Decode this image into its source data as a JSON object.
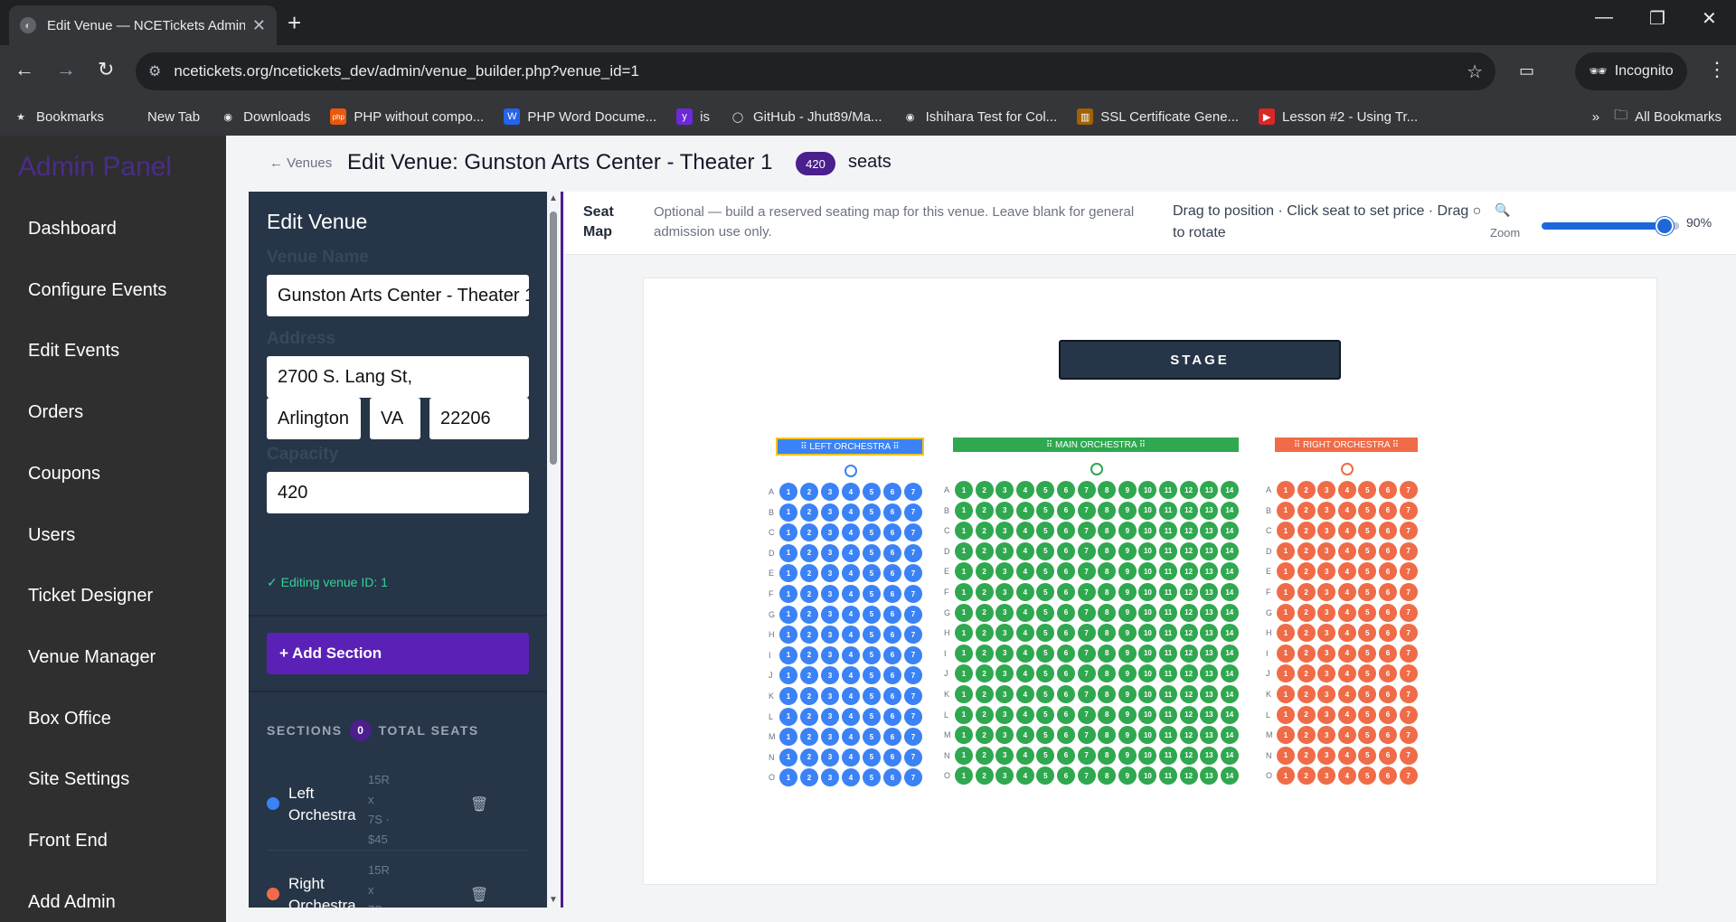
{
  "browser": {
    "tab_title": "Edit Venue — NCETickets Admin",
    "url": "ncetickets.org/ncetickets_dev/admin/venue_builder.php?venue_id=1",
    "profile": "Incognito",
    "bookmarks": [
      {
        "label": "Bookmarks",
        "icon": "star-icon"
      },
      {
        "label": "New Tab",
        "icon": "page-icon"
      },
      {
        "label": "Downloads",
        "icon": "globe-icon"
      },
      {
        "label": "PHP without compo...",
        "icon": "php-icon"
      },
      {
        "label": "PHP Word Docume...",
        "icon": "php-doc-icon"
      },
      {
        "label": "is",
        "icon": "yahoo-icon"
      },
      {
        "label": "GitHub - Jhut89/Ma...",
        "icon": "github-icon"
      },
      {
        "label": "Ishihara Test for Col...",
        "icon": "globe-icon"
      },
      {
        "label": "SSL Certificate Gene...",
        "icon": "ssl-icon"
      },
      {
        "label": "Lesson #2 - Using Tr...",
        "icon": "youtube-icon"
      }
    ],
    "all_bookmarks": "All Bookmarks"
  },
  "sidebar": {
    "title": "Admin Panel",
    "items": [
      "Dashboard",
      "Configure Events",
      "Edit Events",
      "Orders",
      "Coupons",
      "Users",
      "Ticket Designer",
      "Venue Manager",
      "Box Office",
      "Site Settings",
      "Front End",
      "Add Admin"
    ]
  },
  "header": {
    "back": "← Venues",
    "title": "Edit Venue: Gunston Arts Center - Theater 1",
    "seat_count": "420",
    "seat_word": "seats"
  },
  "editor": {
    "heading": "Edit Venue",
    "venue_name_label": "Venue Name",
    "venue_name": "Gunston Arts Center - Theater 1",
    "address_label": "Address",
    "address": "2700 S. Lang St,",
    "city": "Arlington",
    "state": "VA",
    "zip": "22206",
    "capacity_label": "Capacity",
    "capacity": "420",
    "note": "✓ Editing venue ID: 1",
    "add_section": "+ Add Section",
    "sections_label": "SECTIONS",
    "sections_count": "0",
    "total_seats_label": "TOTAL SEATS",
    "sections": [
      {
        "name": "Left Orchestra",
        "meta": [
          "15R",
          "x",
          "7S ·",
          "$45"
        ],
        "color": "#3b82f6"
      },
      {
        "name": "Right Orchestra",
        "meta": [
          "15R",
          "x",
          "7S ·",
          "$45"
        ],
        "color": "#f06b47"
      }
    ]
  },
  "map": {
    "title": "Seat Map",
    "hint": "Optional — build a reserved seating map for this venue. Leave blank for general admission use only.",
    "help": "Drag to position · Click seat to set price · Drag ○ to rotate",
    "zoom_label": "Zoom",
    "zoom_value": "90%",
    "zoom_level": 0.9,
    "stage": "STAGE",
    "rows": [
      "A",
      "B",
      "C",
      "D",
      "E",
      "F",
      "G",
      "H",
      "I",
      "J",
      "K",
      "L",
      "M",
      "N",
      "O"
    ],
    "sections": [
      {
        "label": "⠿ LEFT ORCHESTRA ⠿",
        "seats_per_row": 7,
        "color": "#3b82f6",
        "selected": true
      },
      {
        "label": "⠿ MAIN ORCHESTRA ⠿",
        "seats_per_row": 14,
        "color": "#2fa84f",
        "selected": false
      },
      {
        "label": "⠿ RIGHT ORCHESTRA ⠿",
        "seats_per_row": 7,
        "color": "#f06b47",
        "selected": false
      }
    ]
  }
}
